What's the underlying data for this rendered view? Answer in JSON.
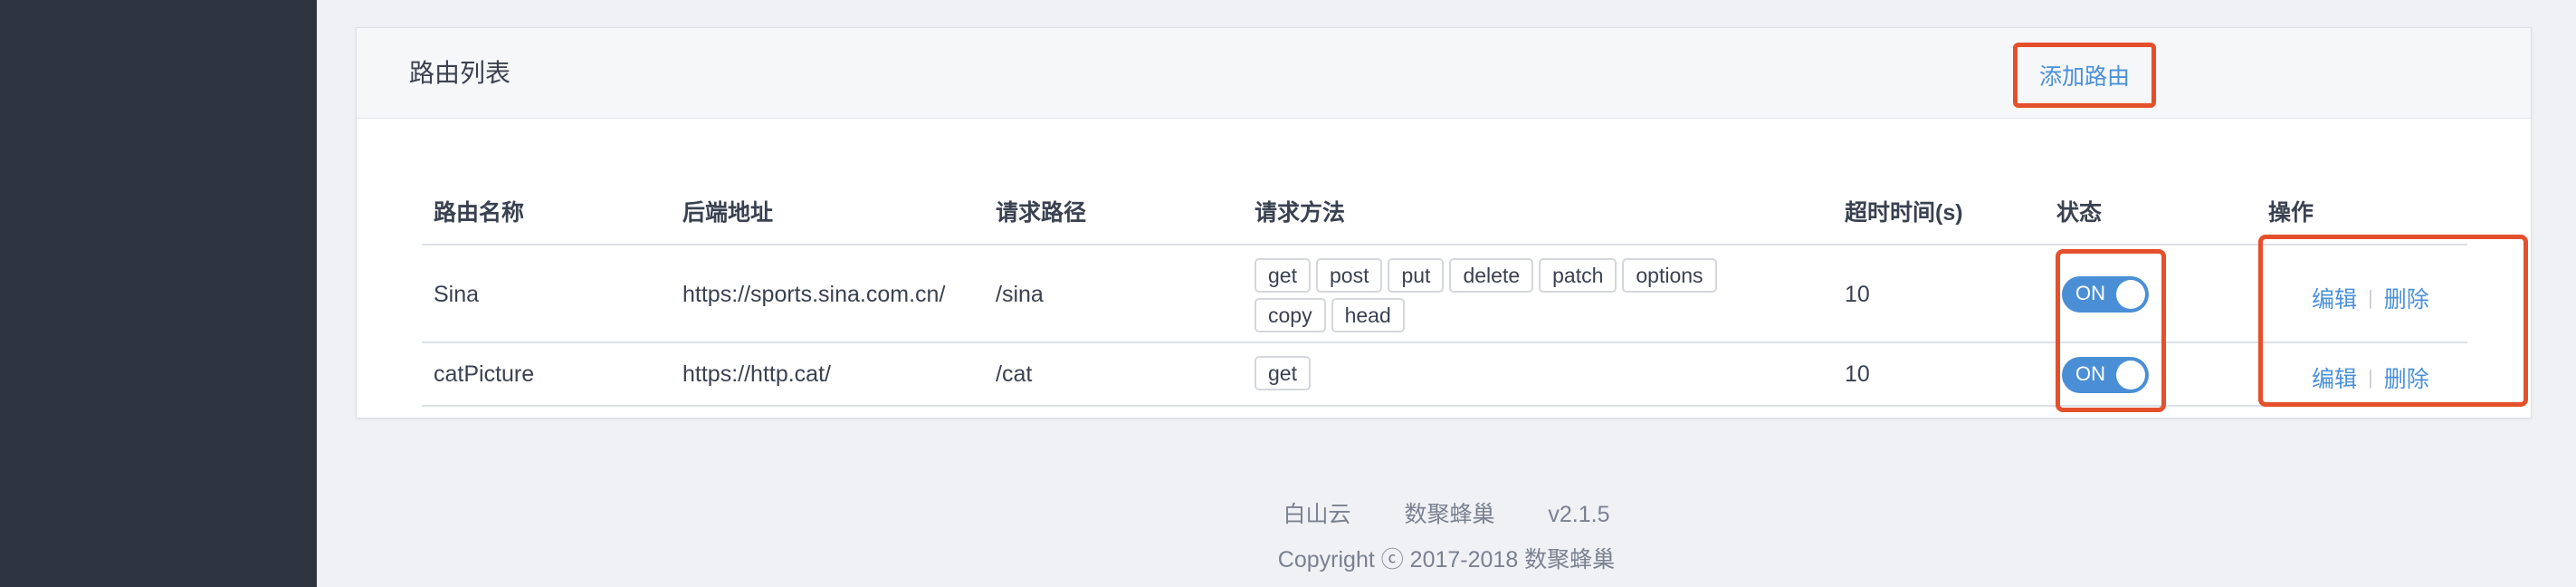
{
  "card": {
    "title": "路由列表",
    "add_button": "添加路由"
  },
  "table": {
    "headers": {
      "name": "路由名称",
      "backend": "后端地址",
      "path": "请求路径",
      "methods": "请求方法",
      "timeout": "超时时间(s)",
      "status": "状态",
      "actions": "操作"
    },
    "rows": [
      {
        "name": "Sina",
        "backend": "https://sports.sina.com.cn/",
        "path": "/sina",
        "methods": [
          "get",
          "post",
          "put",
          "delete",
          "patch",
          "options",
          "copy",
          "head"
        ],
        "timeout": "10",
        "status": "ON",
        "edit": "编辑",
        "delete": "删除"
      },
      {
        "name": "catPicture",
        "backend": "https://http.cat/",
        "path": "/cat",
        "methods": [
          "get"
        ],
        "timeout": "10",
        "status": "ON",
        "edit": "编辑",
        "delete": "删除"
      }
    ]
  },
  "footer": {
    "company": "白山云",
    "product": "数聚蜂巢",
    "version": "v2.1.5",
    "copyright": "Copyright ⓒ 2017-2018 数聚蜂巢"
  },
  "colors": {
    "accent": "#4a90d9",
    "sidebar": "#2f3540",
    "highlight": "#e4502b"
  }
}
